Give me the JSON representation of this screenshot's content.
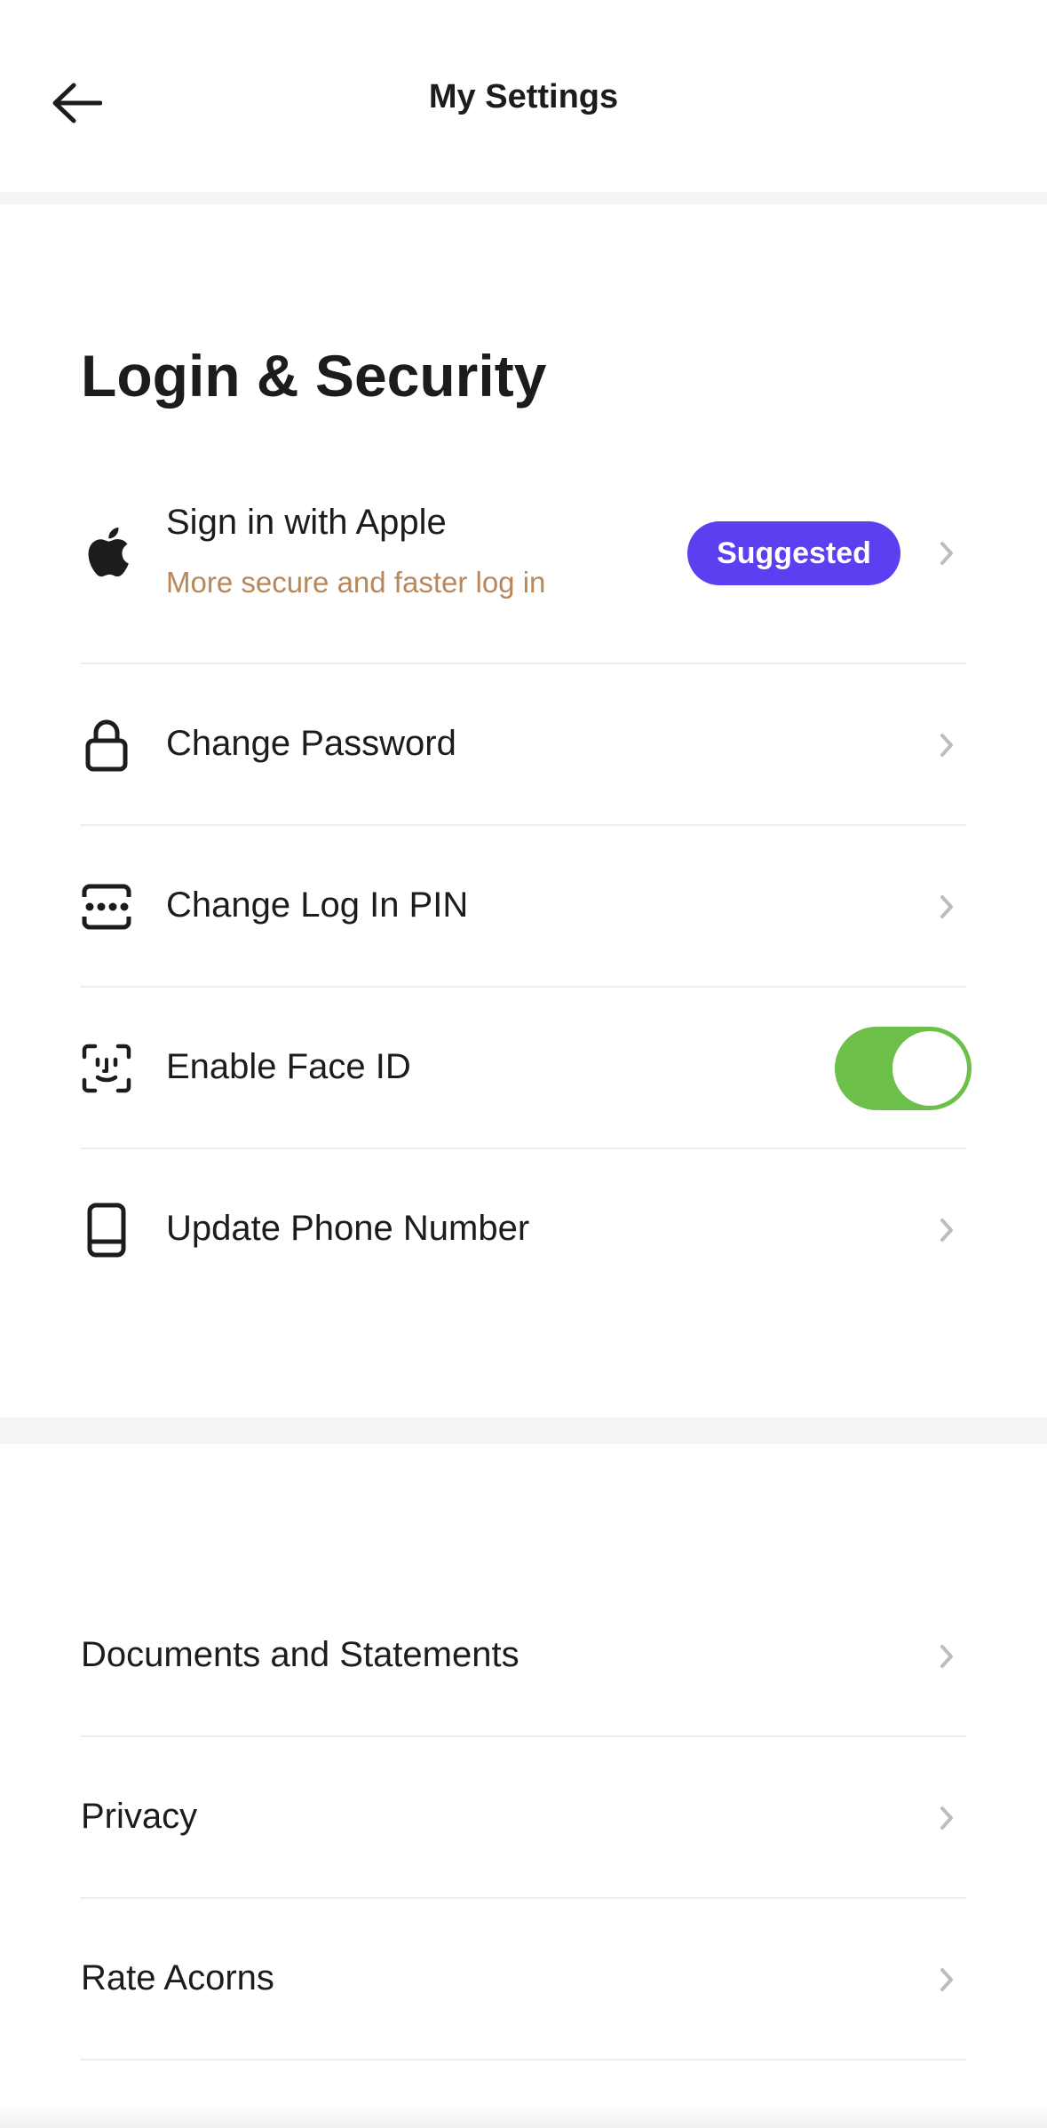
{
  "header": {
    "title": "My Settings",
    "back_icon": "arrow-left-icon"
  },
  "section": {
    "title": "Login & Security"
  },
  "security_items": [
    {
      "label": "Sign in with Apple",
      "subtitle": "More secure and faster log in",
      "badge": "Suggested",
      "icon": "apple-icon"
    },
    {
      "label": "Change Password",
      "icon": "lock-icon"
    },
    {
      "label": "Change Log In PIN",
      "icon": "pin-icon"
    },
    {
      "label": "Enable Face ID",
      "icon": "face-id-icon",
      "toggle_on": true
    },
    {
      "label": "Update Phone Number",
      "icon": "phone-icon"
    }
  ],
  "other_items": [
    {
      "label": "Documents and Statements"
    },
    {
      "label": "Privacy"
    },
    {
      "label": "Rate Acorns"
    }
  ],
  "colors": {
    "badge": "#5b3ff0",
    "subtitle": "#b8885a",
    "toggle": "#6cc04a",
    "divider": "#f4f4f4"
  }
}
